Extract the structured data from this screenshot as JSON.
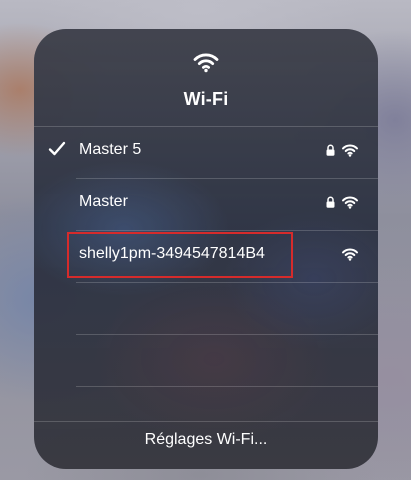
{
  "panel": {
    "title": "Wi-Fi",
    "title_icon": "wifi-icon"
  },
  "networks": [
    {
      "name": "Master 5",
      "connected": true,
      "secured": true,
      "icons": [
        "checkmark-icon",
        "lock-icon",
        "wifi-icon"
      ]
    },
    {
      "name": "Master",
      "connected": false,
      "secured": true,
      "icons": [
        "lock-icon",
        "wifi-icon"
      ]
    },
    {
      "name": "shelly1pm-3494547814B4",
      "connected": false,
      "secured": false,
      "highlighted": true,
      "icons": [
        "wifi-icon"
      ]
    }
  ],
  "footer": {
    "settings_label": "Réglages Wi-Fi..."
  },
  "colors": {
    "highlight_box": "#d62b2b",
    "text": "#ffffff"
  }
}
